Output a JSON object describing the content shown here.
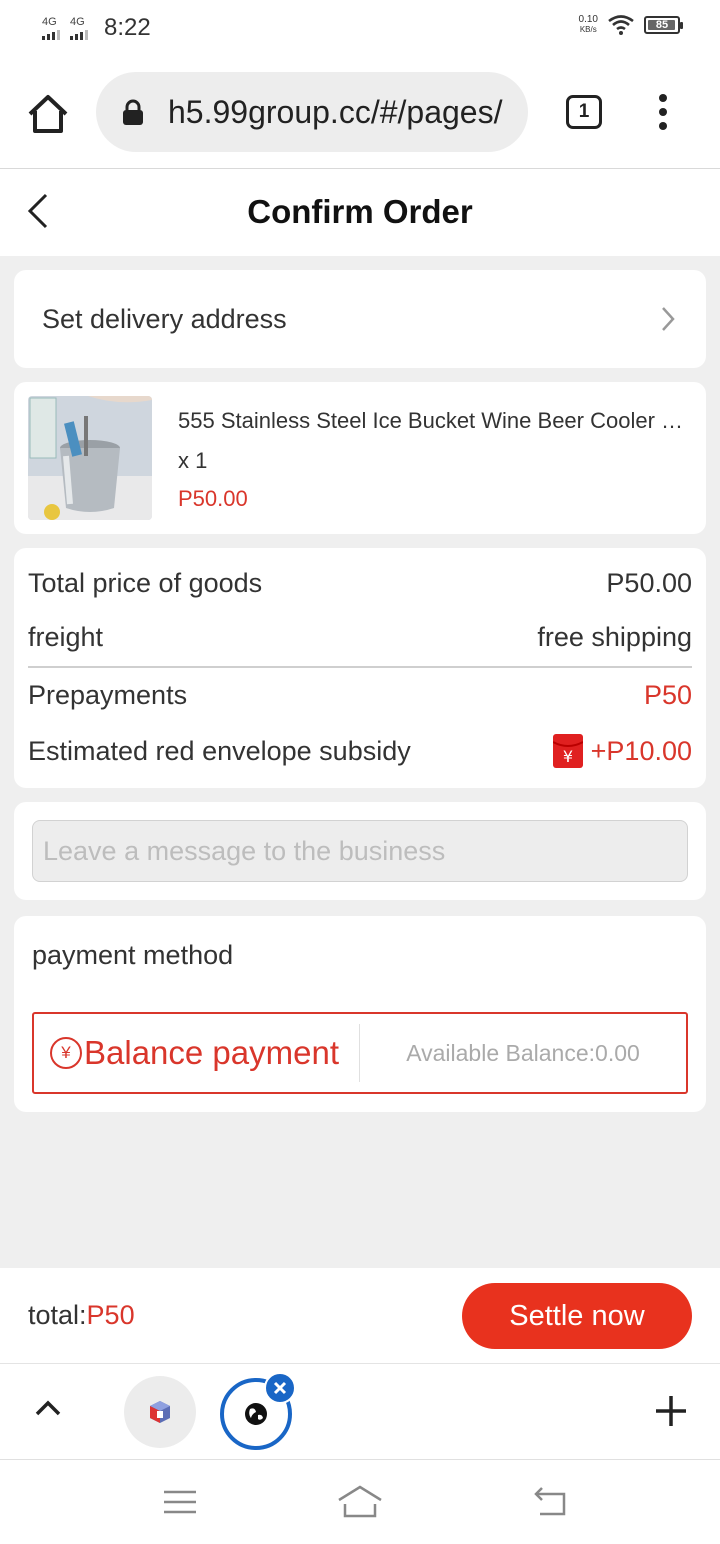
{
  "status_bar": {
    "signal_1": "4G",
    "signal_2": "4G",
    "time": "8:22",
    "net_speed_value": "0.10",
    "net_speed_unit": "KB/s",
    "battery": "85"
  },
  "browser": {
    "url": "h5.99group.cc/#/pages/",
    "tab_count": "1"
  },
  "header": {
    "title": "Confirm Order"
  },
  "address": {
    "label": "Set delivery address"
  },
  "product": {
    "name": "555 Stainless Steel Ice Bucket Wine Beer Cooler …",
    "quantity": "x 1",
    "price": "P50.00"
  },
  "summary": {
    "total_label": "Total price of goods",
    "total_value": "P50.00",
    "freight_label": "freight",
    "freight_value": "free shipping",
    "prepay_label": "Prepayments",
    "prepay_value": "P50",
    "subsidy_label": "Estimated red envelope subsidy",
    "subsidy_value": "+P10.00"
  },
  "message": {
    "placeholder": "Leave a message to the business"
  },
  "payment": {
    "title": "payment method",
    "option_icon": "¥",
    "option_label": "Balance payment",
    "balance": "Available Balance:0.00"
  },
  "footer": {
    "total_label": "total:",
    "total_amount": "P50",
    "settle_label": "Settle now"
  },
  "colors": {
    "accent_red": "#e8321e",
    "price_red": "#d9362b",
    "tab_blue": "#1966c6"
  }
}
